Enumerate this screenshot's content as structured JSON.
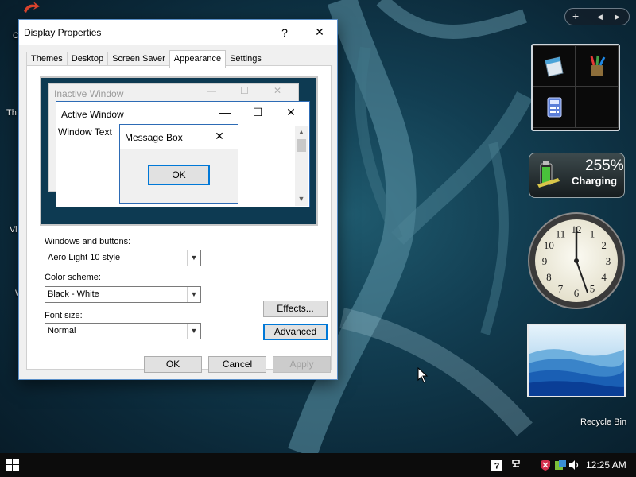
{
  "desktop": {
    "left_labels": [
      "C",
      "Th",
      "Vi",
      "W"
    ],
    "recycle_bin_label": "Recycle Bin"
  },
  "dialog": {
    "title": "Display Properties",
    "help_glyph": "?",
    "close_glyph": "✕",
    "tabs": [
      {
        "label": "Themes",
        "active": false
      },
      {
        "label": "Desktop",
        "active": false
      },
      {
        "label": "Screen Saver",
        "active": false
      },
      {
        "label": "Appearance",
        "active": true
      },
      {
        "label": "Settings",
        "active": false
      }
    ],
    "preview": {
      "inactive_title": "Inactive Window",
      "active_title": "Active Window",
      "window_text": "Window Text",
      "message_box_title": "Message Box",
      "ok_label": "OK"
    },
    "windows_buttons": {
      "label": "Windows and buttons:",
      "value": "Aero Light 10 style"
    },
    "color_scheme": {
      "label": "Color scheme:",
      "value": "Black - White"
    },
    "font_size": {
      "label": "Font size:",
      "value": "Normal"
    },
    "effects_label": "Effects...",
    "advanced_label": "Advanced",
    "ok_label": "OK",
    "cancel_label": "Cancel",
    "apply_label": "Apply"
  },
  "gadgets": {
    "battery_percent": "255%",
    "battery_status": "Charging",
    "clock_time": "12:25"
  },
  "taskbar": {
    "time": "12:25 AM"
  },
  "colors": {
    "accent": "#0078d7",
    "desktop": "#123e52"
  }
}
